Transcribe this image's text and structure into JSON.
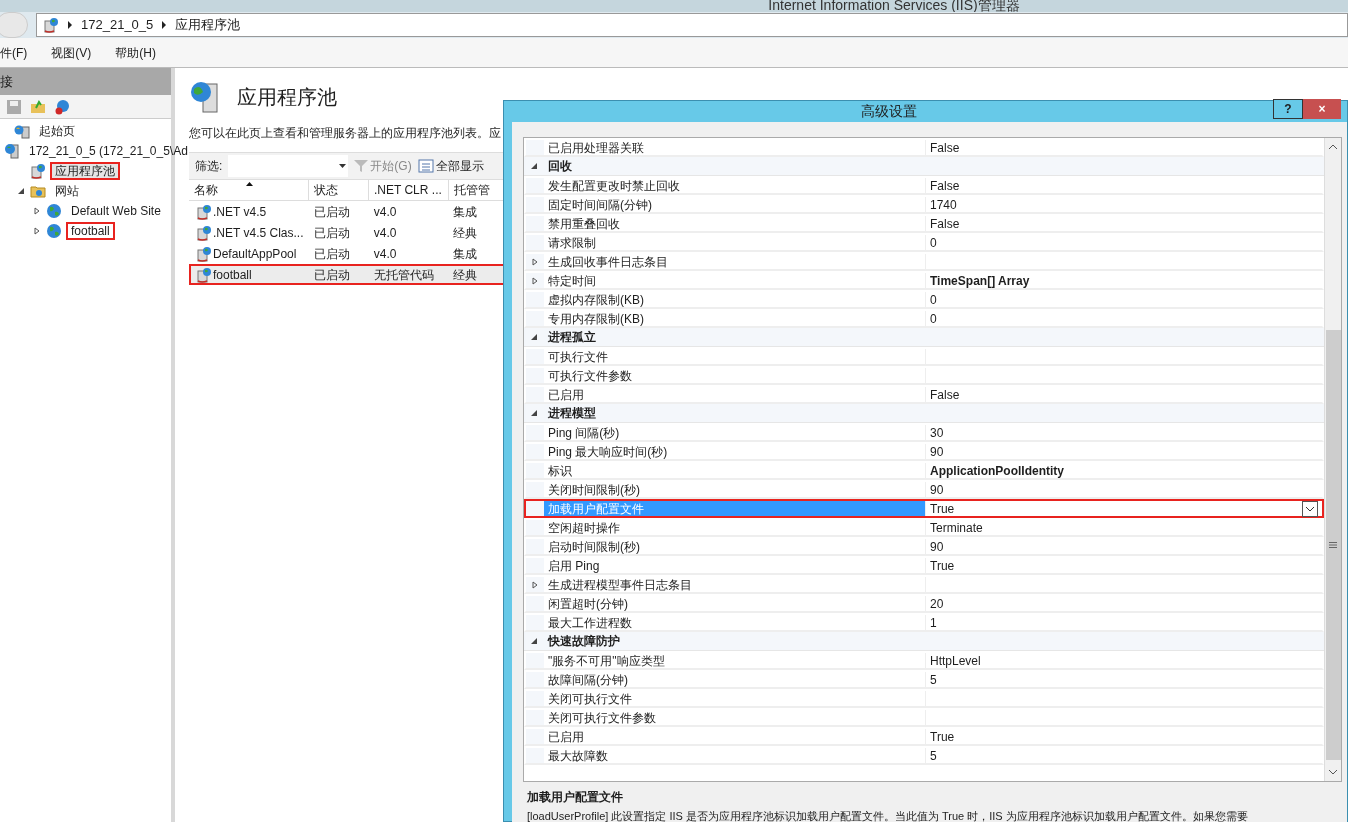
{
  "window": {
    "title": "Internet Information Services (IIS)管理器"
  },
  "address": {
    "segments": [
      "172_21_0_5",
      "应用程序池"
    ]
  },
  "menu": [
    "件(F)",
    "视图(V)",
    "帮助(H)"
  ],
  "connections": {
    "header": "接",
    "tree": [
      {
        "label": "起始页",
        "kind": "start",
        "selected": false,
        "highlighted": false
      },
      {
        "label": "172_21_0_5 (172_21_0_5\\Ad",
        "kind": "server",
        "selected": false,
        "highlighted": false,
        "children": [
          {
            "label": "应用程序池",
            "kind": "pools",
            "selected": true,
            "highlighted": true
          },
          {
            "label": "网站",
            "kind": "sites",
            "selected": false,
            "highlighted": false,
            "expanded": true,
            "children": [
              {
                "label": "Default Web Site",
                "kind": "site",
                "selected": false,
                "highlighted": false,
                "expanded": false
              },
              {
                "label": "football",
                "kind": "site",
                "selected": false,
                "highlighted": true,
                "expanded": false
              }
            ]
          }
        ]
      }
    ]
  },
  "page": {
    "title": "应用程序池",
    "description": "您可以在此页上查看和管理服务器上的应用程序池列表。应",
    "filter": {
      "label": "筛选:",
      "go": "开始(G)",
      "show_all": "全部显示"
    },
    "table": {
      "columns": [
        "名称",
        "状态",
        ".NET CLR ...",
        "托管管"
      ],
      "rows": [
        {
          "cells": [
            ".NET v4.5",
            "已启动",
            "v4.0",
            "集成"
          ],
          "selected": false,
          "highlighted": false
        },
        {
          "cells": [
            ".NET v4.5 Clas...",
            "已启动",
            "v4.0",
            "经典"
          ],
          "selected": false,
          "highlighted": false
        },
        {
          "cells": [
            "DefaultAppPool",
            "已启动",
            "v4.0",
            "集成"
          ],
          "selected": false,
          "highlighted": false
        },
        {
          "cells": [
            "football",
            "已启动",
            "无托管代码",
            "经典"
          ],
          "selected": true,
          "highlighted": true
        }
      ]
    }
  },
  "dialog": {
    "title": "高级设置",
    "help": "?",
    "close": "×",
    "properties": [
      {
        "kind": "property",
        "name": "已启用处理器关联",
        "value": "False",
        "selected": false,
        "highlighted": false
      },
      {
        "kind": "category",
        "name": "回收"
      },
      {
        "kind": "property",
        "name": "发生配置更改时禁止回收",
        "value": "False",
        "selected": false,
        "highlighted": false
      },
      {
        "kind": "property",
        "name": "固定时间间隔(分钟)",
        "value": "1740",
        "selected": false,
        "highlighted": false
      },
      {
        "kind": "property",
        "name": "禁用重叠回收",
        "value": "False",
        "selected": false,
        "highlighted": false
      },
      {
        "kind": "property",
        "name": "请求限制",
        "value": "0",
        "selected": false,
        "highlighted": false
      },
      {
        "kind": "expandable",
        "name": "生成回收事件日志条目",
        "selected": false,
        "highlighted": false
      },
      {
        "kind": "expandable",
        "name": "特定时间",
        "value": "TimeSpan[] Array",
        "bold": true,
        "selected": false,
        "highlighted": false
      },
      {
        "kind": "property",
        "name": "虚拟内存限制(KB)",
        "value": "0",
        "selected": false,
        "highlighted": false
      },
      {
        "kind": "property",
        "name": "专用内存限制(KB)",
        "value": "0",
        "selected": false,
        "highlighted": false
      },
      {
        "kind": "category",
        "name": "进程孤立"
      },
      {
        "kind": "property",
        "name": "可执行文件",
        "selected": false,
        "highlighted": false
      },
      {
        "kind": "property",
        "name": "可执行文件参数",
        "selected": false,
        "highlighted": false
      },
      {
        "kind": "property",
        "name": "已启用",
        "value": "False",
        "selected": false,
        "highlighted": false
      },
      {
        "kind": "category",
        "name": "进程模型"
      },
      {
        "kind": "property",
        "name": "Ping 间隔(秒)",
        "value": "30",
        "selected": false,
        "highlighted": false
      },
      {
        "kind": "property",
        "name": "Ping 最大响应时间(秒)",
        "value": "90",
        "selected": false,
        "highlighted": false
      },
      {
        "kind": "property",
        "name": "标识",
        "value": "ApplicationPoolIdentity",
        "bold": true,
        "selected": false,
        "highlighted": false
      },
      {
        "kind": "property",
        "name": "关闭时间限制(秒)",
        "value": "90",
        "selected": false,
        "highlighted": false
      },
      {
        "kind": "property",
        "name": "加载用户配置文件",
        "value": "True",
        "selected": true,
        "highlighted": true
      },
      {
        "kind": "property",
        "name": "空闲超时操作",
        "value": "Terminate",
        "selected": false,
        "highlighted": false
      },
      {
        "kind": "property",
        "name": "启动时间限制(秒)",
        "value": "90",
        "selected": false,
        "highlighted": false
      },
      {
        "kind": "property",
        "name": "启用 Ping",
        "value": "True",
        "selected": false,
        "highlighted": false
      },
      {
        "kind": "expandable",
        "name": "生成进程模型事件日志条目",
        "selected": false,
        "highlighted": false
      },
      {
        "kind": "property",
        "name": "闲置超时(分钟)",
        "value": "20",
        "selected": false,
        "highlighted": false
      },
      {
        "kind": "property",
        "name": "最大工作进程数",
        "value": "1",
        "selected": false,
        "highlighted": false
      },
      {
        "kind": "category",
        "name": "快速故障防护"
      },
      {
        "kind": "property",
        "name": "\"服务不可用\"响应类型",
        "value": "HttpLevel",
        "selected": false,
        "highlighted": false
      },
      {
        "kind": "property",
        "name": "故障间隔(分钟)",
        "value": "5",
        "selected": false,
        "highlighted": false
      },
      {
        "kind": "property",
        "name": "关闭可执行文件",
        "selected": false,
        "highlighted": false
      },
      {
        "kind": "property",
        "name": "关闭可执行文件参数",
        "selected": false,
        "highlighted": false
      },
      {
        "kind": "property",
        "name": "已启用",
        "value": "True",
        "selected": false,
        "highlighted": false
      },
      {
        "kind": "property",
        "name": "最大故障数",
        "value": "5",
        "selected": false,
        "highlighted": false
      }
    ],
    "help_title": "加载用户配置文件",
    "help_text": "[loadUserProfile] 此设置指定 IIS 是否为应用程序池标识加载用户配置文件。当此值为 True 时，IIS 为应用程序池标识加载用户配置文件。如果您需要"
  }
}
